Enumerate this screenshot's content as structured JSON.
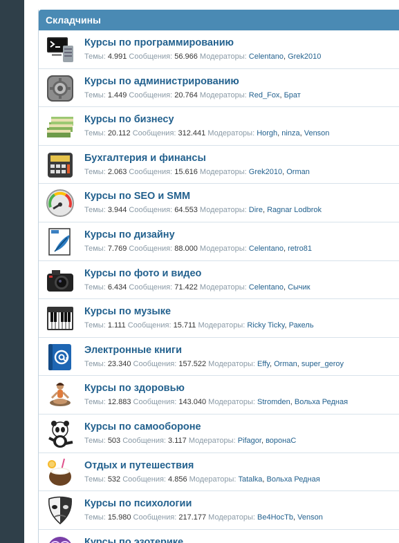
{
  "panel": {
    "title": "Складчины"
  },
  "labels": {
    "topics": "Темы:",
    "messages": "Сообщения:",
    "moderators": "Модераторы:"
  },
  "forums": [
    {
      "title": "Курсы по программированию",
      "topics": "4.991",
      "messages": "56.966",
      "mods": [
        "Celentano",
        "Grek2010"
      ],
      "icon": "terminal-icon"
    },
    {
      "title": "Курсы по администрированию",
      "topics": "1.449",
      "messages": "20.764",
      "mods": [
        "Red_Fox",
        "Брат"
      ],
      "icon": "gear-icon"
    },
    {
      "title": "Курсы по бизнесу",
      "topics": "20.112",
      "messages": "312.441",
      "mods": [
        "Horgh",
        "ninza",
        "Venson"
      ],
      "icon": "money-icon"
    },
    {
      "title": "Бухгалтерия и финансы",
      "topics": "2.063",
      "messages": "15.616",
      "mods": [
        "Grek2010",
        "Orman"
      ],
      "icon": "calculator-icon"
    },
    {
      "title": "Курсы по SEO и SMM",
      "topics": "3.944",
      "messages": "64.553",
      "mods": [
        "Dire",
        "Ragnar Lodbrok"
      ],
      "icon": "gauge-icon"
    },
    {
      "title": "Курсы по дизайну",
      "topics": "7.769",
      "messages": "88.000",
      "mods": [
        "Celentano",
        "retro81"
      ],
      "icon": "feather-icon"
    },
    {
      "title": "Курсы по фото и видео",
      "topics": "6.434",
      "messages": "71.422",
      "mods": [
        "Celentano",
        "Сычик"
      ],
      "icon": "camera-icon"
    },
    {
      "title": "Курсы по музыке",
      "topics": "1.111",
      "messages": "15.711",
      "mods": [
        "Ricky Ticky",
        "Ракель"
      ],
      "icon": "piano-icon"
    },
    {
      "title": "Электронные книги",
      "topics": "23.340",
      "messages": "157.522",
      "mods": [
        "Effy",
        "Orman",
        "super_geroy"
      ],
      "icon": "address-book-icon"
    },
    {
      "title": "Курсы по здоровью",
      "topics": "12.883",
      "messages": "143.040",
      "mods": [
        "Stromden",
        "Вольха Редная"
      ],
      "icon": "yoga-icon"
    },
    {
      "title": "Курсы по самообороне",
      "topics": "503",
      "messages": "3.117",
      "mods": [
        "Pifagor",
        "воронаС"
      ],
      "icon": "panda-icon"
    },
    {
      "title": "Отдых и путешествия",
      "topics": "532",
      "messages": "4.856",
      "mods": [
        "Tatalka",
        "Вольха Редная"
      ],
      "icon": "coconut-icon"
    },
    {
      "title": "Курсы по психологии",
      "topics": "15.980",
      "messages": "217.177",
      "mods": [
        "Be4HocTb",
        "Venson"
      ],
      "icon": "mask-icon"
    },
    {
      "title": "Курсы по эзотерике",
      "topics": "",
      "messages": "",
      "mods": [],
      "icon": "esoteric-icon"
    }
  ]
}
